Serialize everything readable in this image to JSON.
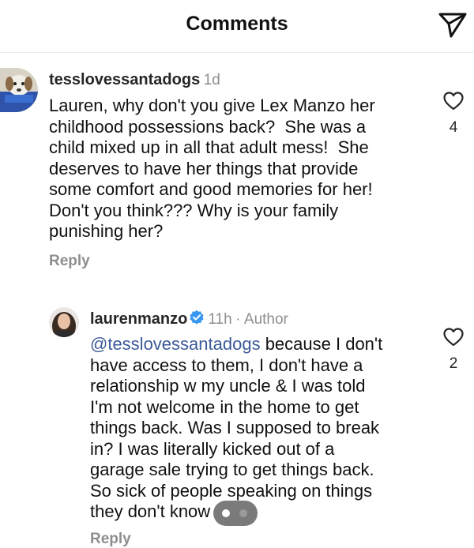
{
  "header": {
    "title": "Comments",
    "share_icon": "paper-plane-icon"
  },
  "comments": [
    {
      "username": "tesslovessantadogs",
      "time": "1d",
      "text": "Lauren, why don't you give Lex Manzo her\nchildhood possessions back?  She was a\nchild mixed up in all that adult mess!  She\ndeserves to have her things that provide\nsome comfort and good memories for her!\nDon't you think??? Why is your family\npunishing her?",
      "reply_label": "Reply",
      "likes": "4",
      "like_icon": "heart-outline-icon"
    },
    {
      "username": "laurenmanzo",
      "verified_icon": "verified-badge-icon",
      "time": "11h",
      "separator": "·",
      "author_label": "Author",
      "mention": "@tesslovessantadogs",
      "text_after_mention": " because I don't\nhave access to them, I don't have a\nrelationship w my uncle & I was told\nI'm not welcome in the home to get\nthings back. Was I supposed to break\nin? I was literally kicked out of a\ngarage sale trying to get things back.\nSo sick of people speaking on things\nthey don't know",
      "reply_label": "Reply",
      "likes": "2",
      "like_icon": "heart-outline-icon"
    }
  ],
  "colors": {
    "mention": "#3c5a99",
    "muted": "#8e8e8e",
    "verified": "#3897f0"
  }
}
